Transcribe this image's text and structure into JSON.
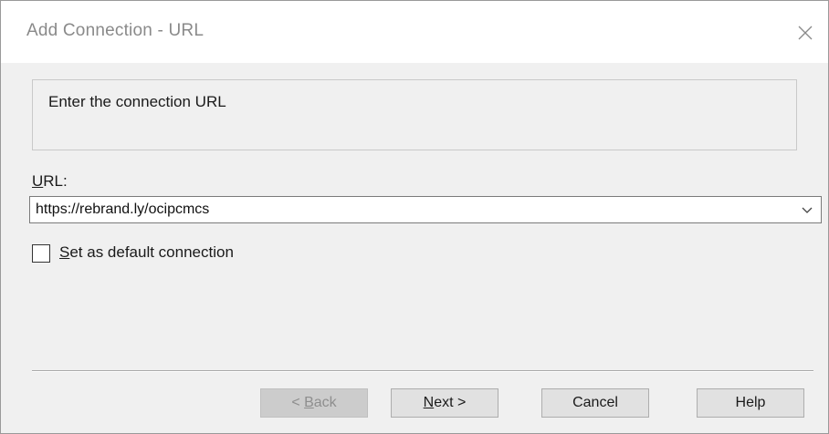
{
  "window": {
    "title": "Add Connection - URL",
    "close_icon": "close-icon"
  },
  "instruction": {
    "text": "Enter the connection URL"
  },
  "url": {
    "label_mnemonic": "U",
    "label_rest": "RL:",
    "value": "https://rebrand.ly/ocipcmcs",
    "dropdown_icon": "chevron-down-icon"
  },
  "default_connection": {
    "label_mnemonic": "S",
    "label_rest": "et as default connection",
    "checked": false
  },
  "buttons": {
    "back": {
      "prefix": "< ",
      "mnemonic": "B",
      "rest": "ack",
      "enabled": false
    },
    "next": {
      "mnemonic": "N",
      "rest": "ext >",
      "enabled": true
    },
    "cancel": {
      "label": "Cancel",
      "enabled": true
    },
    "help": {
      "label": "Help",
      "enabled": true
    }
  },
  "colors": {
    "dialog_bg": "#f0f0f0",
    "title_bg": "#ffffff",
    "title_text": "#8a8a8a",
    "button_bg": "#e1e1e1",
    "button_disabled_bg": "#cccccc"
  }
}
